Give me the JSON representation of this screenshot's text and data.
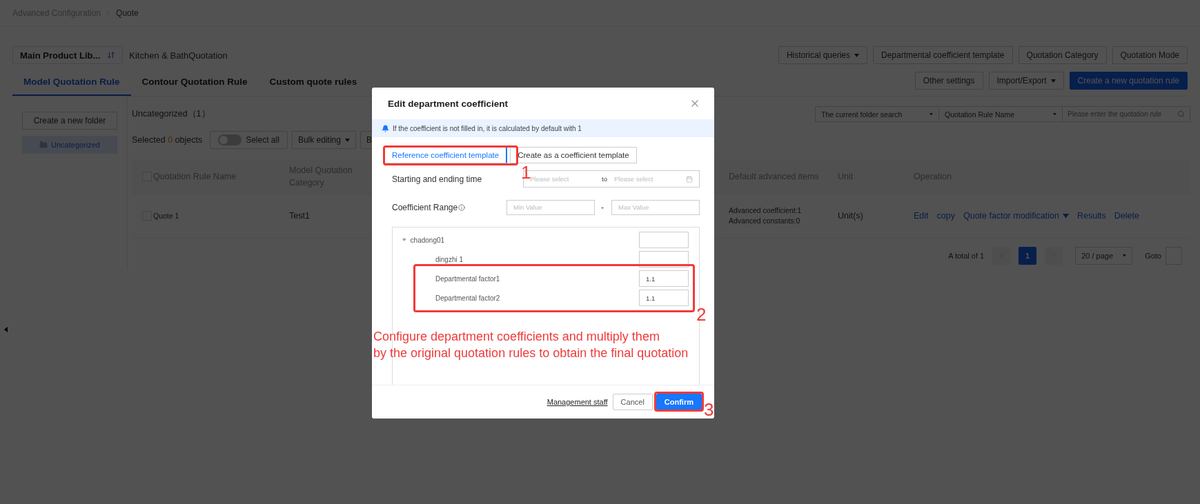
{
  "breadcrumb": [
    "Advanced Configuration",
    "Quote"
  ],
  "library": {
    "name": "Main Product Lib...",
    "title": "Kitchen & BathQuotation"
  },
  "header_buttons": [
    {
      "label": "Historical queries",
      "dropdown": true
    },
    {
      "label": "Departmental coefficient template",
      "dropdown": false
    },
    {
      "label": "Quotation Category",
      "dropdown": false
    },
    {
      "label": "Quotation Mode",
      "dropdown": false
    }
  ],
  "tabs": [
    {
      "label": "Model Quotation Rule",
      "selected": true
    },
    {
      "label": "Contour Quotation Rule",
      "selected": false
    },
    {
      "label": "Custom quote rules",
      "selected": false
    }
  ],
  "actions": [
    {
      "label": "Other settings",
      "kind": "plain"
    },
    {
      "label": "Import/Export",
      "kind": "dropdown"
    },
    {
      "label": "Create a new quotation rule",
      "kind": "primary"
    }
  ],
  "sidebar": {
    "create_button": "Create a new folder",
    "folders": [
      {
        "label": "Uncategorized",
        "selected": true
      }
    ]
  },
  "folder": {
    "title": "Uncategorized",
    "count": "（1）"
  },
  "selection": {
    "prefix": "Selected",
    "count": "0",
    "suffix": "objects"
  },
  "toolbar": {
    "switch": {
      "label": "Select all",
      "on": false
    },
    "buttons": [
      {
        "label": "Bulk editing",
        "dropdown": true
      },
      {
        "label": "B",
        "dropdown": false
      }
    ]
  },
  "filters": {
    "scope": "The current folder search",
    "field": "Quotation Rule Name",
    "search": {
      "placeholder": "Please enter the quotation rule"
    }
  },
  "table": {
    "header_checked": false,
    "columns": [
      "Quotation Rule Name",
      "Model Quotation Category",
      "Default advanced items",
      "Unit",
      "Operation"
    ],
    "rows": [
      {
        "checked": false,
        "name": "Quote 1",
        "category": "Test1",
        "advanced": [
          "Advanced coefficient:1",
          "Advanced constants:0"
        ],
        "unit": "Unit(s)",
        "operations": [
          {
            "label": "Edit",
            "dropdown": false
          },
          {
            "label": "copy",
            "dropdown": false
          },
          {
            "label": "Quote factor modification",
            "dropdown": true
          },
          {
            "label": "Results",
            "dropdown": false
          },
          {
            "label": "Delete",
            "dropdown": false
          }
        ]
      }
    ]
  },
  "pagination": {
    "total": "A total of 1",
    "pages": [
      {
        "label": "1",
        "selected": true
      }
    ],
    "page_size": "20 / page",
    "goto": "Goto"
  },
  "modal": {
    "title": "Edit department coefficient",
    "notice": "If the coefficient is not filled in, it is calculated by default with 1",
    "modes": [
      {
        "label": "Reference coefficient template",
        "selected": true
      },
      {
        "label": "Create as a coefficient template",
        "selected": false
      }
    ],
    "time": {
      "label": "Starting and ending time",
      "start_placeholder": "Please select",
      "separator": "to",
      "end_placeholder": "Please select"
    },
    "range": {
      "label": "Coefficient Range",
      "min_placeholder": "Min Value",
      "separator": "-",
      "max_placeholder": "Max Value"
    },
    "tree": [
      {
        "label": "chadong01",
        "expanded": true,
        "children": [
          {
            "label": "dingzhi 1"
          },
          {
            "label": "Departmental factor1",
            "value": "1.1"
          },
          {
            "label": "Departmental factor2",
            "value": "1.1"
          }
        ]
      }
    ],
    "footer": {
      "link": "Management staff",
      "cancel": "Cancel",
      "confirm": "Confirm"
    }
  },
  "annotations": {
    "markers": [
      "1",
      "2",
      "3"
    ],
    "note_lines": [
      "Configure department coefficients and multiply them",
      "by the original quotation rules to obtain the final quotation"
    ]
  }
}
